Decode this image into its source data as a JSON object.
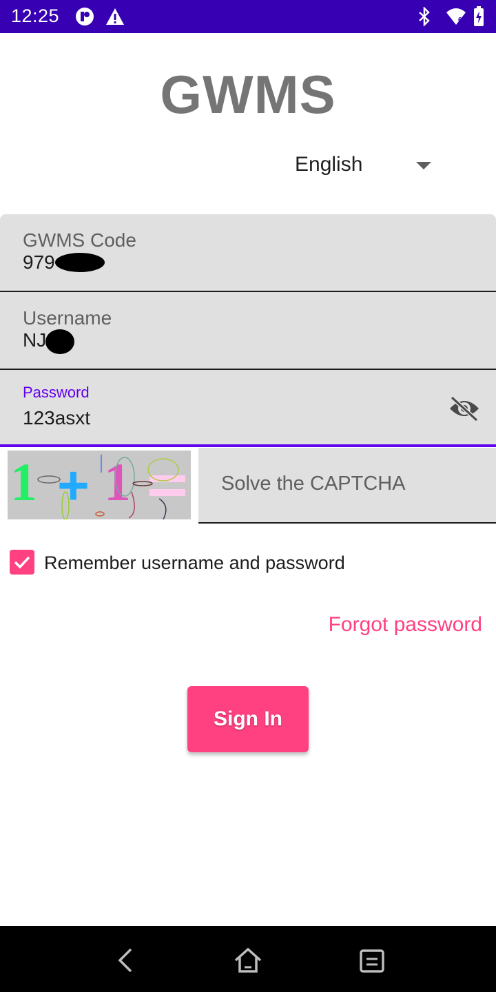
{
  "status_bar": {
    "time": "12:25",
    "icons": [
      "app-notification-icon",
      "warning-icon",
      "bluetooth-icon",
      "wifi-icon",
      "battery-icon"
    ],
    "background": "#3700b3"
  },
  "app": {
    "title": "GWMS"
  },
  "language": {
    "selected": "English"
  },
  "form": {
    "gwms_code": {
      "label": "GWMS Code",
      "value": "979"
    },
    "username": {
      "label": "Username",
      "value": "NJ"
    },
    "password": {
      "label": "Password",
      "value": "123asxt",
      "toggle_icon": "visibility-off-icon"
    },
    "captcha": {
      "placeholder": "Solve the CAPTCHA",
      "image_text": "1+1="
    },
    "remember": {
      "label": "Remember username and password",
      "checked": true
    },
    "forgot_password": "Forgot password",
    "sign_in": "Sign In"
  },
  "colors": {
    "accent": "#ff4081",
    "primary": "#6200ee",
    "primary_dark": "#3700b3",
    "field_background": "#e0e0e0"
  },
  "nav_bar": {
    "icons": [
      "back-icon",
      "home-icon",
      "recents-icon"
    ]
  }
}
